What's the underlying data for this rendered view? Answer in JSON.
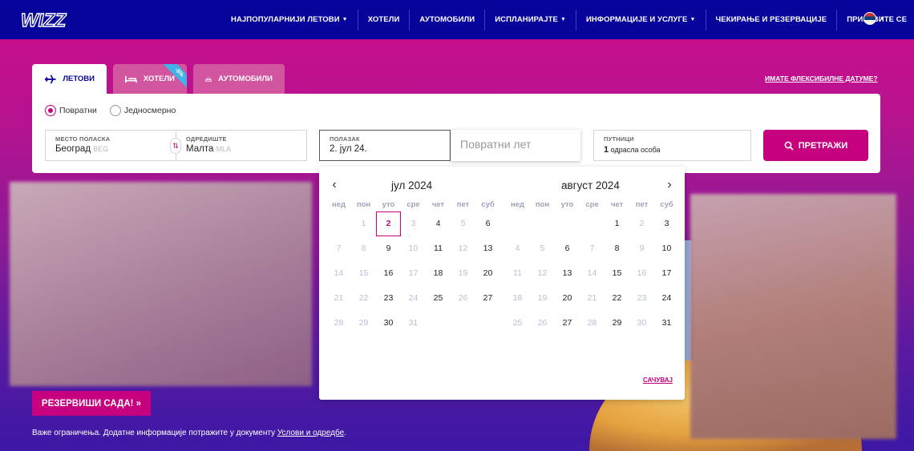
{
  "nav": {
    "items": [
      {
        "label": "НАЈПОПУЛАРНИЈИ ЛЕТОВИ",
        "caret": true
      },
      {
        "label": "ХОТЕЛИ",
        "caret": false
      },
      {
        "label": "АУТОМОБИЛИ",
        "caret": false
      },
      {
        "label": "ИСПЛАНИРАЈТЕ",
        "caret": true
      },
      {
        "label": "ИНФОРМАЦИЈЕ И УСЛУГЕ",
        "caret": true
      },
      {
        "label": "ЧЕКИРАЊЕ И РЕЗЕРВАЦИЈЕ",
        "caret": false
      },
      {
        "label": "ПРИЈАВИТЕ СЕ",
        "caret": false
      }
    ],
    "lang_icon": "serbia-flag-icon"
  },
  "tabs": {
    "flights": "ЛЕТОВИ",
    "hotels": "ХОТЕЛИ",
    "hotels_badge": "-5%",
    "cars": "АУТОМОБИЛИ"
  },
  "flexible_dates_link": "ИМАТЕ ФЛЕКСИБИЛНЕ ДАТУМЕ?",
  "trip_type": {
    "return_label": "Повратни",
    "oneway_label": "Једносмерно",
    "selected": "return"
  },
  "form": {
    "origin_label": "МЕСТО ПОЛАСКА",
    "origin_value": "Београд",
    "origin_code": "BEG",
    "destination_label": "ОДРЕДИШТЕ",
    "destination_value": "Малта",
    "destination_code": "MLA",
    "departure_label": "ПОЛАЗАК",
    "departure_value": "2. јул 24.",
    "return_placeholder": "Повратни лет",
    "passengers_label": "ПУТНИЦИ",
    "passengers_count": "1",
    "passengers_type": "одрасла особа",
    "search_label": "ПРЕТРАЖИ"
  },
  "calendar": {
    "weekdays": [
      "нед",
      "пон",
      "уто",
      "сре",
      "чет",
      "пет",
      "суб"
    ],
    "months": [
      {
        "title": "јул 2024",
        "weeks": [
          [
            {
              "d": ""
            },
            {
              "d": "1",
              "dis": true
            },
            {
              "d": "2",
              "sel": true
            },
            {
              "d": "3",
              "dis": true
            },
            {
              "d": "4"
            },
            {
              "d": "5",
              "dis": true
            },
            {
              "d": "6"
            }
          ],
          [
            {
              "d": "7",
              "dis": true
            },
            {
              "d": "8",
              "dis": true
            },
            {
              "d": "9"
            },
            {
              "d": "10",
              "dis": true
            },
            {
              "d": "11"
            },
            {
              "d": "12",
              "dis": true
            },
            {
              "d": "13"
            }
          ],
          [
            {
              "d": "14",
              "dis": true
            },
            {
              "d": "15",
              "dis": true
            },
            {
              "d": "16"
            },
            {
              "d": "17",
              "dis": true
            },
            {
              "d": "18"
            },
            {
              "d": "19",
              "dis": true
            },
            {
              "d": "20"
            }
          ],
          [
            {
              "d": "21",
              "dis": true
            },
            {
              "d": "22",
              "dis": true
            },
            {
              "d": "23"
            },
            {
              "d": "24",
              "dis": true
            },
            {
              "d": "25"
            },
            {
              "d": "26",
              "dis": true
            },
            {
              "d": "27"
            }
          ],
          [
            {
              "d": "28",
              "dis": true
            },
            {
              "d": "29",
              "dis": true
            },
            {
              "d": "30"
            },
            {
              "d": "31",
              "dis": true
            },
            {
              "d": ""
            },
            {
              "d": ""
            },
            {
              "d": ""
            }
          ]
        ]
      },
      {
        "title": "август 2024",
        "weeks": [
          [
            {
              "d": ""
            },
            {
              "d": ""
            },
            {
              "d": ""
            },
            {
              "d": ""
            },
            {
              "d": "1"
            },
            {
              "d": "2",
              "dis": true
            },
            {
              "d": "3"
            }
          ],
          [
            {
              "d": "4",
              "dis": true
            },
            {
              "d": "5",
              "dis": true
            },
            {
              "d": "6"
            },
            {
              "d": "7",
              "dis": true
            },
            {
              "d": "8"
            },
            {
              "d": "9",
              "dis": true
            },
            {
              "d": "10"
            }
          ],
          [
            {
              "d": "11",
              "dis": true
            },
            {
              "d": "12",
              "dis": true
            },
            {
              "d": "13"
            },
            {
              "d": "14",
              "dis": true
            },
            {
              "d": "15"
            },
            {
              "d": "16",
              "dis": true
            },
            {
              "d": "17"
            }
          ],
          [
            {
              "d": "18",
              "dis": true
            },
            {
              "d": "19",
              "dis": true
            },
            {
              "d": "20"
            },
            {
              "d": "21",
              "dis": true
            },
            {
              "d": "22"
            },
            {
              "d": "23",
              "dis": true
            },
            {
              "d": "24"
            }
          ],
          [
            {
              "d": "25",
              "dis": true
            },
            {
              "d": "26",
              "dis": true
            },
            {
              "d": "27"
            },
            {
              "d": "28",
              "dis": true
            },
            {
              "d": "29"
            },
            {
              "d": "30",
              "dis": true
            },
            {
              "d": "31"
            }
          ]
        ]
      }
    ],
    "save_label": "САЧУВАЈ"
  },
  "hero": {
    "reserve_label": "РЕЗЕРВИШИ САДА! »",
    "note_text": "Важе ограничења. Додатне информације потражите у документу ",
    "note_link": "Услови и одредбе",
    "note_end": "."
  },
  "colors": {
    "brand_blue": "#06049a",
    "brand_magenta": "#c6007e"
  }
}
